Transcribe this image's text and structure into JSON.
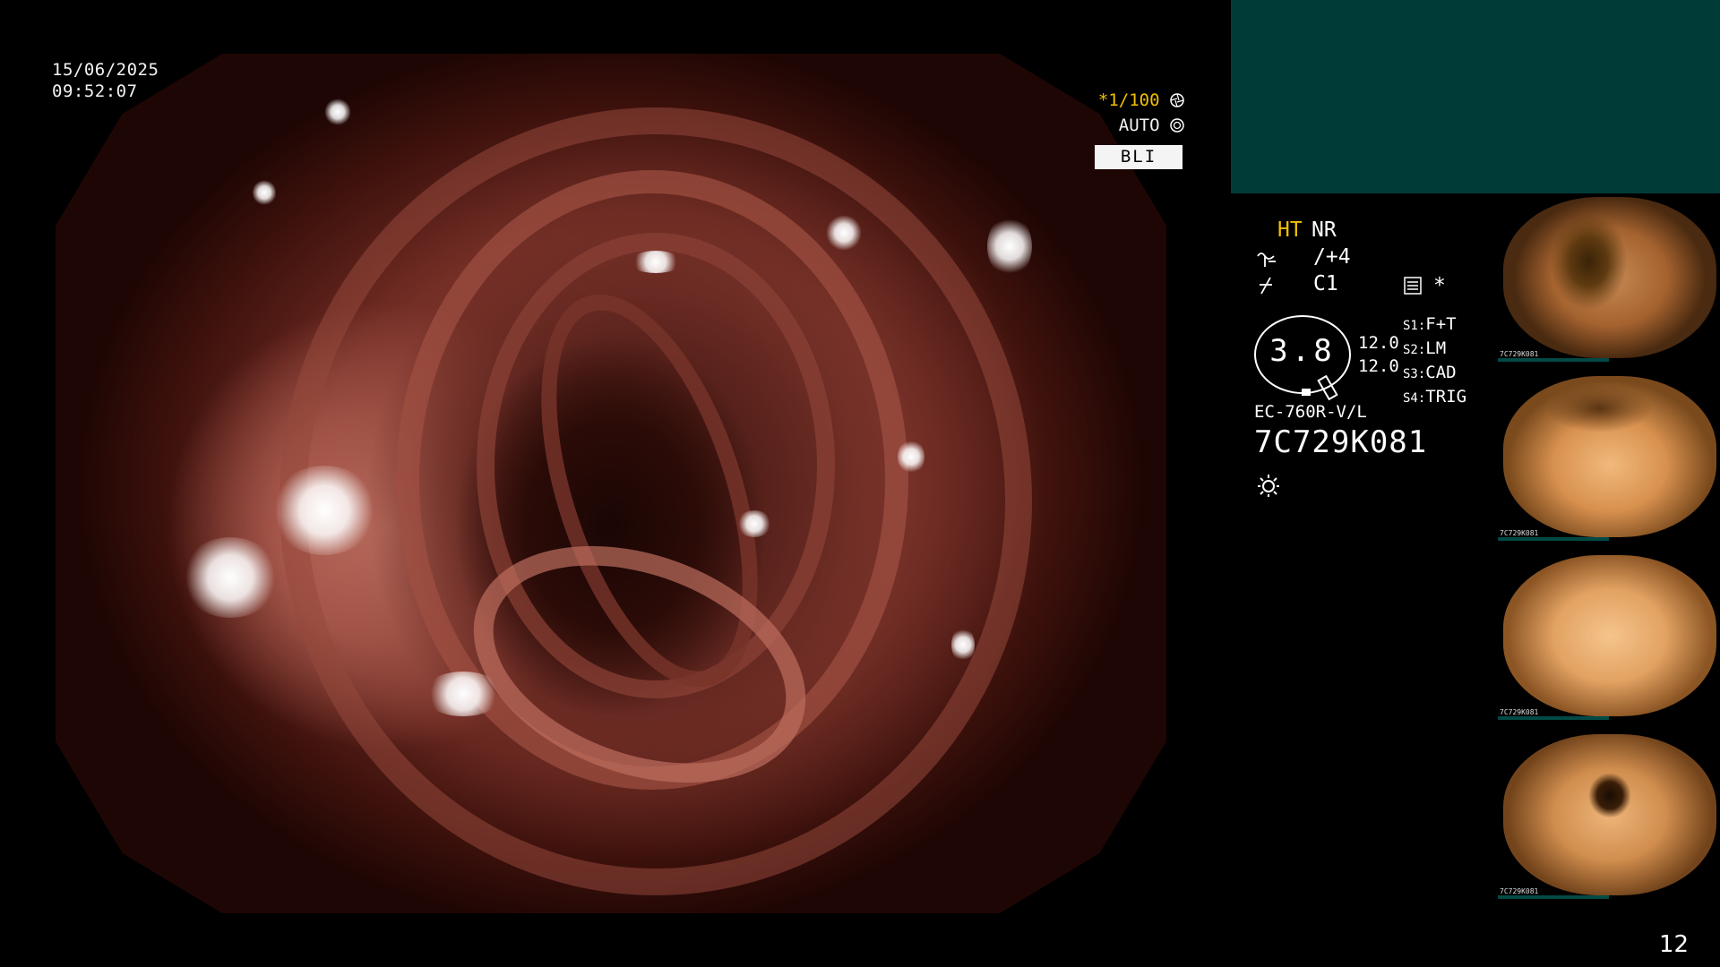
{
  "overlay": {
    "date": "15/06/2025",
    "time": "09:52:07",
    "shutter": "*1/100",
    "exposure": "AUTO",
    "mode": "BLI"
  },
  "info": {
    "ht": "HT",
    "nr": "NR",
    "enhancement": "/+4",
    "color": "C1",
    "asterisk": "*",
    "gauge_value": "3.8",
    "gauge_top": "12.0",
    "gauge_bottom": "12.0",
    "s_settings": [
      {
        "key": "S1:",
        "value": "F+T"
      },
      {
        "key": "S2:",
        "value": "LM"
      },
      {
        "key": "S3:",
        "value": "CAD"
      },
      {
        "key": "S4:",
        "value": "TRIG"
      }
    ],
    "model": "EC-760R-V/L",
    "serial": "7C729K081"
  },
  "thumbnails": [
    {
      "label": "7C729K081"
    },
    {
      "label": "7C729K081"
    },
    {
      "label": "7C729K081"
    },
    {
      "label": "7C729K081"
    }
  ],
  "page_number": "12",
  "colors": {
    "accent": "#f0c000",
    "panel": "#003b38",
    "background": "#000000"
  },
  "icons": {
    "shutter": "shutter-icon",
    "exposure": "exposure-icon",
    "structure": "structure-enhancement-icon",
    "color": "color-enhancement-icon",
    "menu": "menu-icon",
    "light": "light-source-icon"
  }
}
